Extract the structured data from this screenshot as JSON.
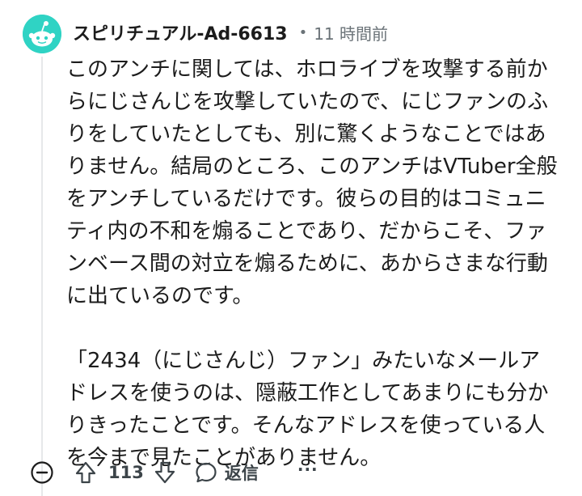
{
  "comment": {
    "author": {
      "username": "スピリチュアル-Ad-6613",
      "avatar_icon": "reddit-snoo-icon",
      "avatar_color": "#2fd3c4"
    },
    "separator": "•",
    "timestamp": "11 時間前",
    "paragraphs": [
      "このアンチに関しては、ホロライブを攻撃する前からにじさんじを攻撃していたので、にじファンのふりをしていたとしても、別に驚くようなことではありません。結局のところ、このアンチはVTuber全般をアンチしているだけです。彼らの目的はコミュニティ内の不和を煽ることであり、だからこそ、ファンベース間の対立を煽るために、あからさまな行動に出ているのです。",
      "「2434（にじさんじ）ファン」みたいなメールアドレスを使うのは、隠蔽工作としてあまりにも分かりきったことです。そんなアドレスを使っている人を今まで見たことがありません。"
    ],
    "actions": {
      "collapse_icon": "collapse-minus-icon",
      "upvote_icon": "upvote-arrow-icon",
      "vote_count": "113",
      "downvote_icon": "downvote-arrow-icon",
      "reply_icon": "speech-bubble-icon",
      "reply_label": "返信",
      "more_label": "···"
    }
  }
}
